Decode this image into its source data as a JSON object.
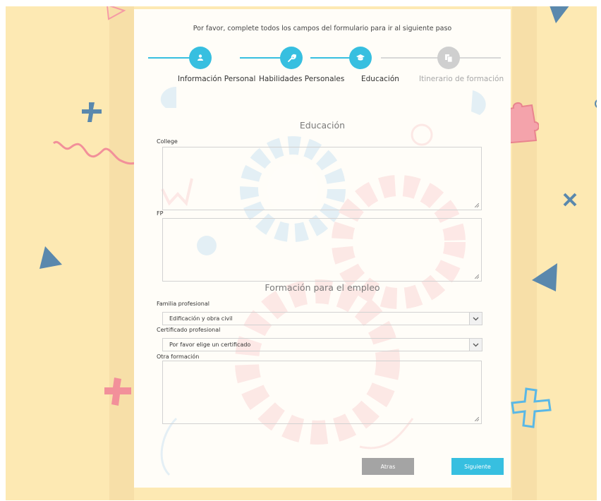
{
  "intro": "Por favor, complete todos los campos del formulario para ir al siguiente paso",
  "steps": [
    {
      "label": "Información Personal",
      "icon": "person-icon",
      "state": "active"
    },
    {
      "label": "Habilidades Personales",
      "icon": "wrench-icon",
      "state": "active"
    },
    {
      "label": "Educación",
      "icon": "graduation-cap-icon",
      "state": "active"
    },
    {
      "label": "Itinerario de formación",
      "icon": "documents-icon",
      "state": "inactive"
    }
  ],
  "education": {
    "title": "Educación",
    "college_label": "College",
    "fp_label": "FP"
  },
  "training": {
    "title": "Formación para el empleo",
    "familia_label": "Familia profesional",
    "familia_value": "Edificación y obra civil",
    "certificado_label": "Certificado profesional",
    "certificado_value": "Por favor elige un certificado",
    "otra_label": "Otra formación"
  },
  "buttons": {
    "back": "Atras",
    "next": "Siguiente"
  },
  "colors": {
    "accent": "#37bfe0",
    "inactive": "#cfcfcf",
    "background": "#fde9b3",
    "back_button": "#a4a4a4"
  }
}
